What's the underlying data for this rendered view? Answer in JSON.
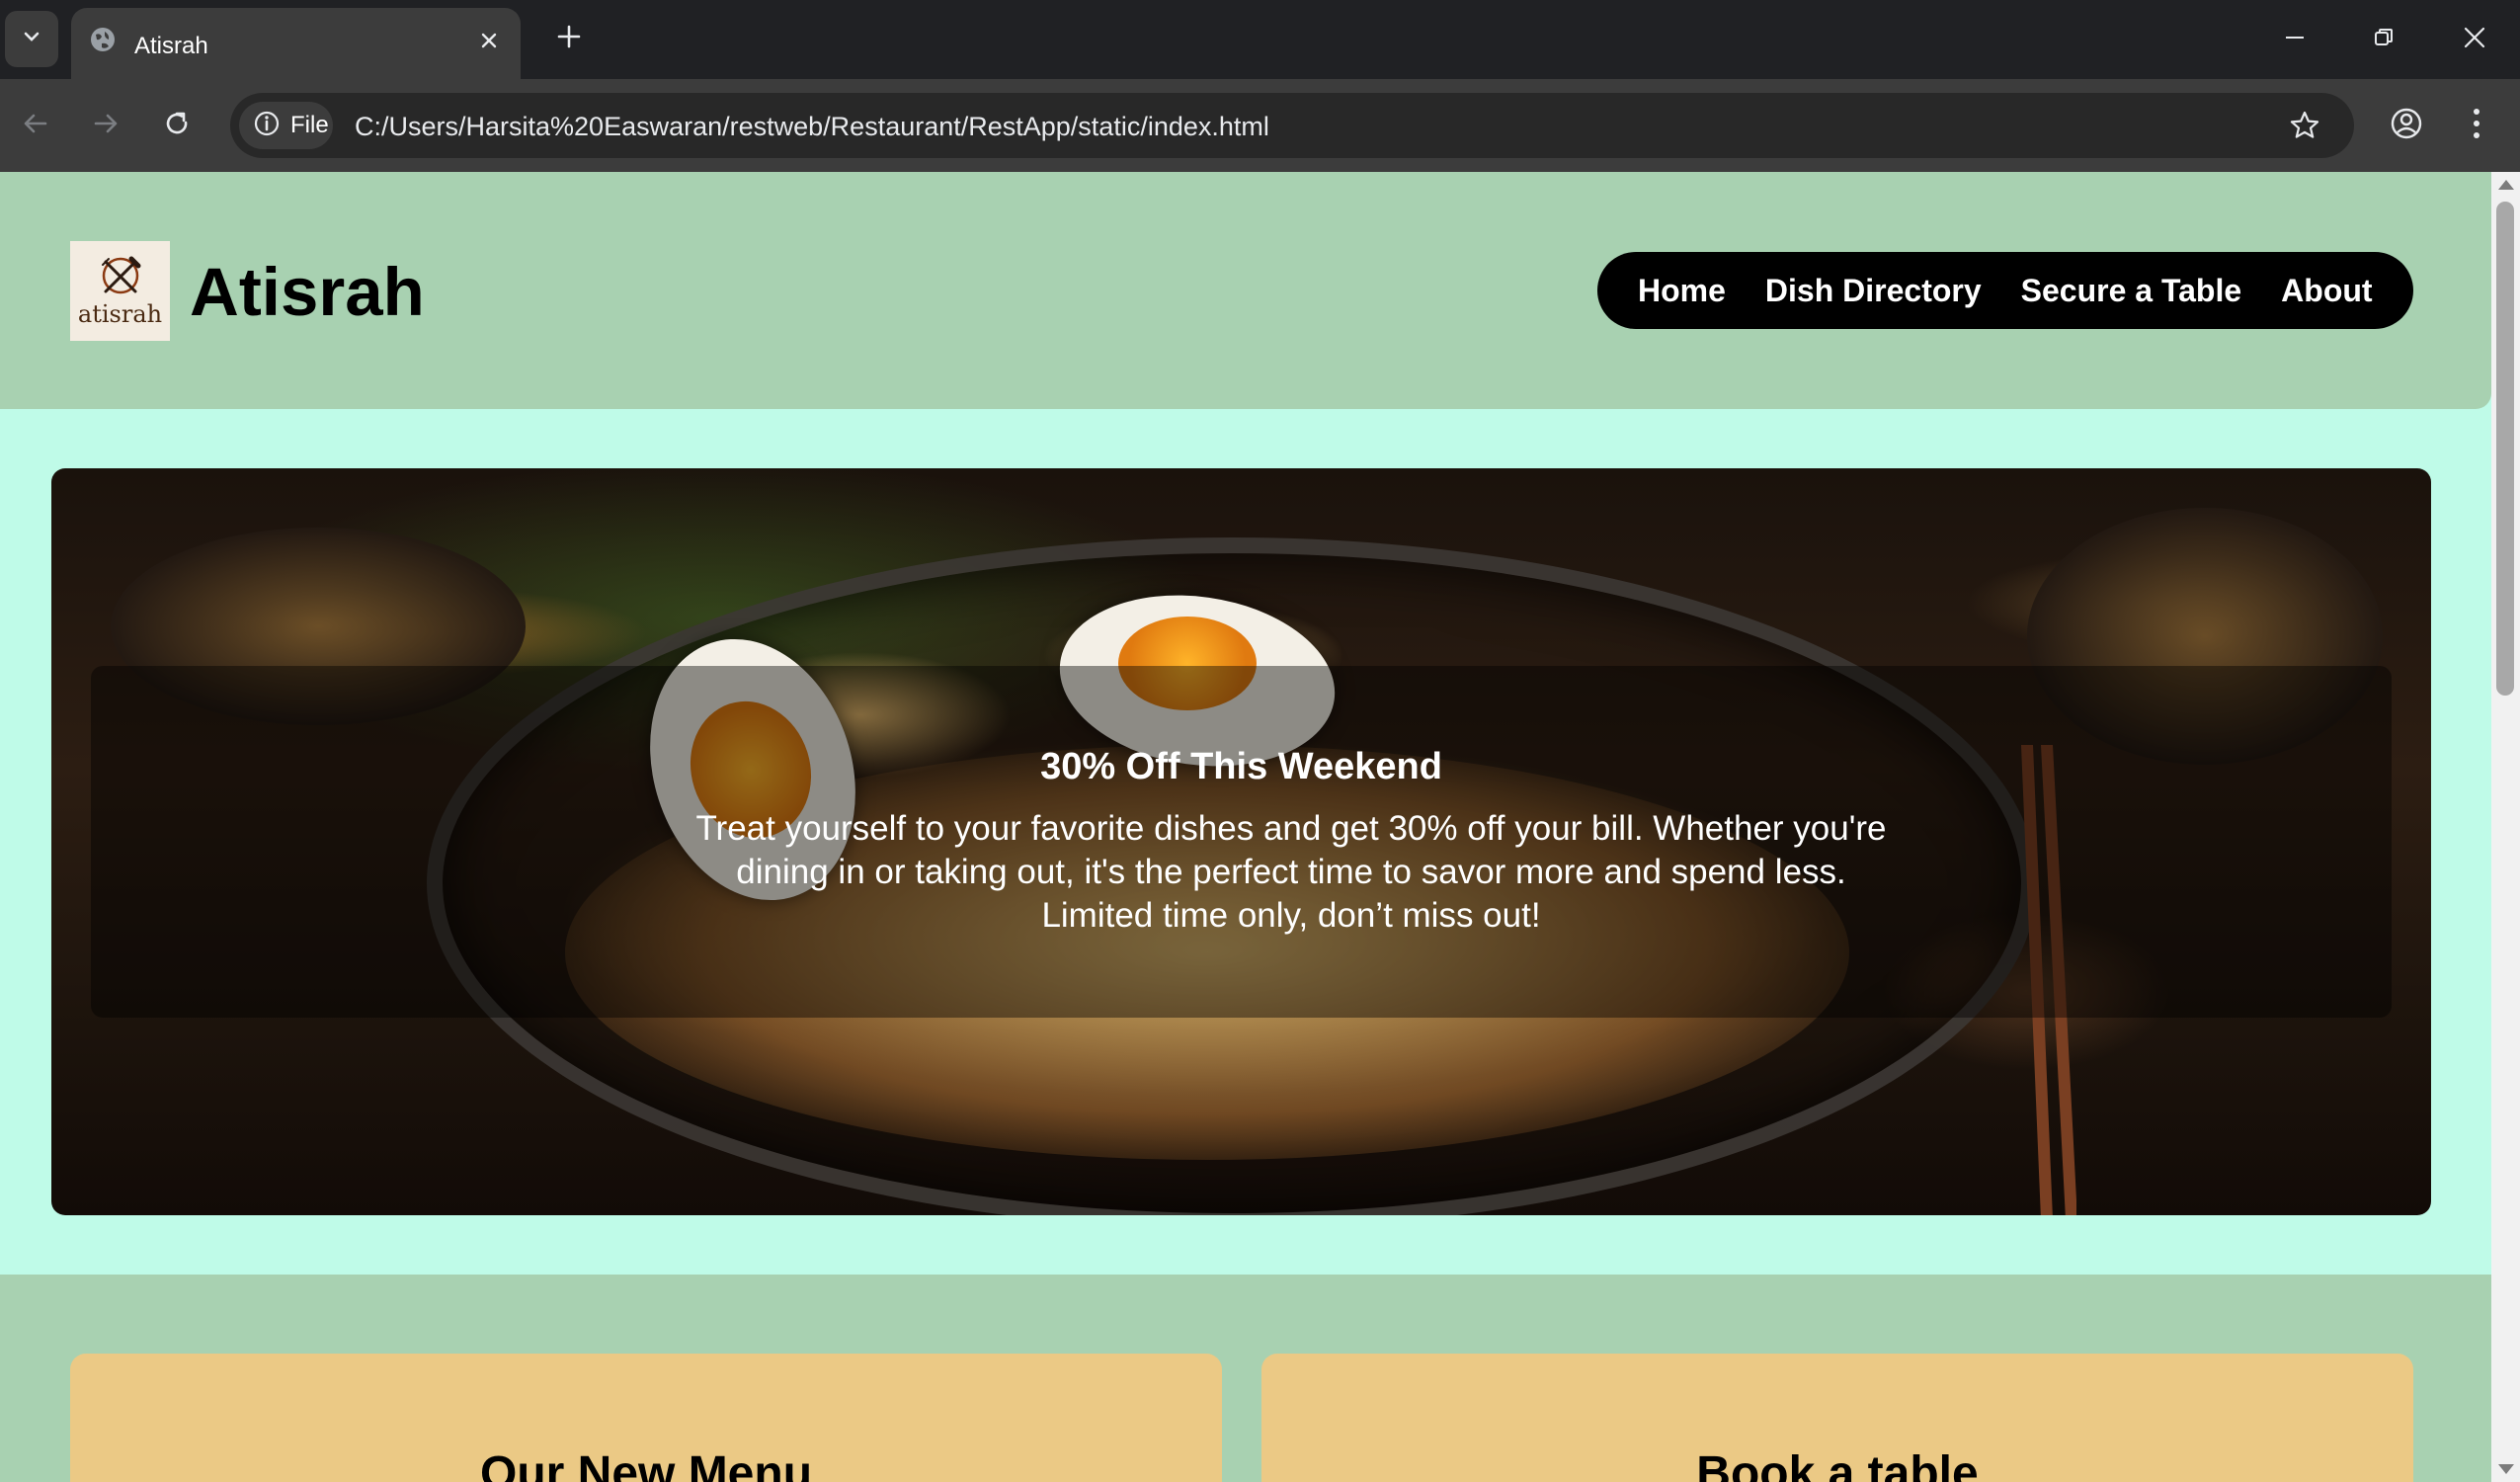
{
  "browser": {
    "tab_title": "Atisrah",
    "chip_label": "File",
    "url": "C:/Users/Harsita%20Easwaran/restweb/Restaurant/RestApp/static/index.html"
  },
  "site": {
    "brand": "Atisrah",
    "logo_text": "atisrah",
    "nav": [
      "Home",
      "Dish Directory",
      "Secure a Table",
      "About"
    ]
  },
  "hero": {
    "title": "30% Off This Weekend",
    "description": "Treat yourself to your favorite dishes and get 30% off your bill. Whether you're dining in or taking out, it's the perfect time to savor more and spend less. Limited time only, don’t miss out!"
  },
  "cards": [
    "Our New Menu",
    "Book a table"
  ],
  "colors": {
    "header_bg": "#a8d1b1",
    "page_bg": "#bffbe8",
    "nav_bg": "#000000",
    "card_bg": "#ebc985"
  }
}
